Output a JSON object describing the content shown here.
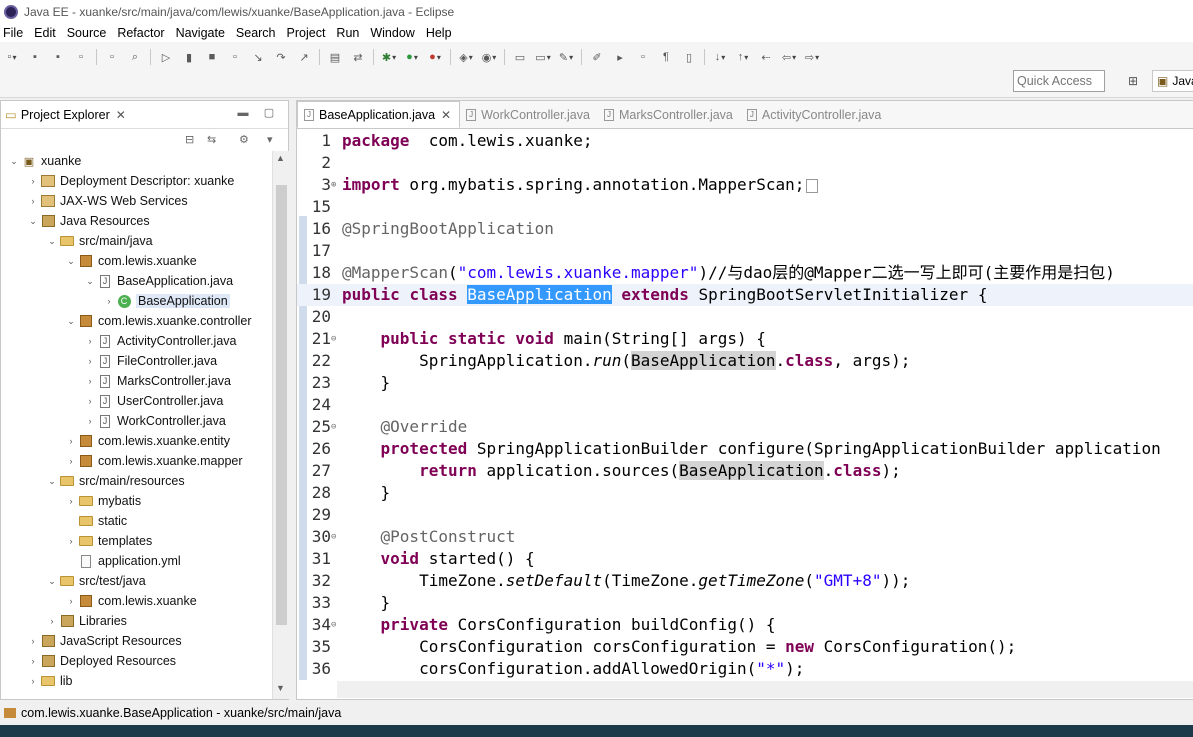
{
  "window": {
    "title": "Java EE - xuanke/src/main/java/com/lewis/xuanke/BaseApplication.java - Eclipse"
  },
  "menu": [
    "File",
    "Edit",
    "Source",
    "Refactor",
    "Navigate",
    "Search",
    "Project",
    "Run",
    "Window",
    "Help"
  ],
  "toolbar": {
    "quick_access": "Quick Access",
    "perspective": "Java"
  },
  "explorer": {
    "title": "Project Explorer",
    "tree": [
      {
        "depth": 0,
        "twisty": "open",
        "icon": "project",
        "label": "xuanke"
      },
      {
        "depth": 1,
        "twisty": "closed",
        "icon": "dd",
        "label": "Deployment Descriptor: xuanke"
      },
      {
        "depth": 1,
        "twisty": "closed",
        "icon": "dd",
        "label": "JAX-WS Web Services"
      },
      {
        "depth": 1,
        "twisty": "open",
        "icon": "lib",
        "label": "Java Resources"
      },
      {
        "depth": 2,
        "twisty": "open",
        "icon": "pkgfolder",
        "label": "src/main/java"
      },
      {
        "depth": 3,
        "twisty": "open",
        "icon": "pkg",
        "label": "com.lewis.xuanke"
      },
      {
        "depth": 4,
        "twisty": "open",
        "icon": "java",
        "label": "BaseApplication.java"
      },
      {
        "depth": 5,
        "twisty": "closed",
        "icon": "class",
        "label": "BaseApplication",
        "selected": true
      },
      {
        "depth": 3,
        "twisty": "open",
        "icon": "pkg",
        "label": "com.lewis.xuanke.controller"
      },
      {
        "depth": 4,
        "twisty": "closed",
        "icon": "java",
        "label": "ActivityController.java"
      },
      {
        "depth": 4,
        "twisty": "closed",
        "icon": "java",
        "label": "FileController.java"
      },
      {
        "depth": 4,
        "twisty": "closed",
        "icon": "java",
        "label": "MarksController.java"
      },
      {
        "depth": 4,
        "twisty": "closed",
        "icon": "java",
        "label": "UserController.java"
      },
      {
        "depth": 4,
        "twisty": "closed",
        "icon": "java",
        "label": "WorkController.java"
      },
      {
        "depth": 3,
        "twisty": "closed",
        "icon": "pkg",
        "label": "com.lewis.xuanke.entity"
      },
      {
        "depth": 3,
        "twisty": "closed",
        "icon": "pkg",
        "label": "com.lewis.xuanke.mapper"
      },
      {
        "depth": 2,
        "twisty": "open",
        "icon": "pkgfolder",
        "label": "src/main/resources"
      },
      {
        "depth": 3,
        "twisty": "closed",
        "icon": "folder",
        "label": "mybatis"
      },
      {
        "depth": 3,
        "twisty": "none",
        "icon": "folder",
        "label": "static"
      },
      {
        "depth": 3,
        "twisty": "closed",
        "icon": "folder",
        "label": "templates"
      },
      {
        "depth": 3,
        "twisty": "none",
        "icon": "file",
        "label": "application.yml"
      },
      {
        "depth": 2,
        "twisty": "open",
        "icon": "pkgfolder",
        "label": "src/test/java"
      },
      {
        "depth": 3,
        "twisty": "closed",
        "icon": "pkg",
        "label": "com.lewis.xuanke"
      },
      {
        "depth": 2,
        "twisty": "closed",
        "icon": "lib",
        "label": "Libraries"
      },
      {
        "depth": 1,
        "twisty": "closed",
        "icon": "lib",
        "label": "JavaScript Resources"
      },
      {
        "depth": 1,
        "twisty": "closed",
        "icon": "lib",
        "label": "Deployed Resources"
      },
      {
        "depth": 1,
        "twisty": "closed",
        "icon": "folder",
        "label": "lib"
      }
    ]
  },
  "editor": {
    "tabs": [
      {
        "label": "BaseApplication.java",
        "active": true
      },
      {
        "label": "WorkController.java",
        "active": false
      },
      {
        "label": "MarksController.java",
        "active": false
      },
      {
        "label": "ActivityController.java",
        "active": false
      }
    ],
    "lines": [
      {
        "n": "1",
        "fold": "",
        "segs": [
          [
            "kw",
            "package"
          ],
          [
            "",
            "  com.lewis.xuanke;"
          ]
        ]
      },
      {
        "n": "2",
        "fold": "",
        "segs": []
      },
      {
        "n": "3",
        "fold": "⊕",
        "segs": [
          [
            "kw",
            "import"
          ],
          [
            "",
            " org.mybatis.spring.annotation.MapperScan;"
          ],
          [
            "box",
            ""
          ]
        ]
      },
      {
        "n": "15",
        "fold": "",
        "segs": []
      },
      {
        "n": "16",
        "fold": "",
        "segs": [
          [
            "ann",
            "@SpringBootApplication"
          ]
        ]
      },
      {
        "n": "17",
        "fold": "",
        "segs": []
      },
      {
        "n": "18",
        "fold": "",
        "segs": [
          [
            "ann",
            "@MapperScan"
          ],
          [
            "",
            "("
          ],
          [
            "str",
            "\"com.lewis.xuanke.mapper\""
          ],
          [
            "",
            ")//与dao层的@Mapper二选一写上即可(主要作用是扫包)"
          ]
        ]
      },
      {
        "n": "19",
        "fold": "",
        "cur": true,
        "segs": [
          [
            "kw",
            "public"
          ],
          [
            "",
            " "
          ],
          [
            "kw",
            "class"
          ],
          [
            "",
            " "
          ],
          [
            "sel",
            "BaseApplication"
          ],
          [
            "",
            " "
          ],
          [
            "kw",
            "extends"
          ],
          [
            "",
            " SpringBootServletInitializer {"
          ]
        ]
      },
      {
        "n": "20",
        "fold": "",
        "segs": []
      },
      {
        "n": "21",
        "fold": "⊖",
        "segs": [
          [
            "",
            "    "
          ],
          [
            "kw",
            "public"
          ],
          [
            "",
            " "
          ],
          [
            "kw",
            "static"
          ],
          [
            "",
            " "
          ],
          [
            "kw",
            "void"
          ],
          [
            "",
            " main(String[] args) {"
          ]
        ]
      },
      {
        "n": "22",
        "fold": "",
        "segs": [
          [
            "",
            "        SpringApplication."
          ],
          [
            "it",
            "run"
          ],
          [
            "",
            "("
          ],
          [
            "hl",
            "BaseApplication"
          ],
          [
            "",
            "."
          ],
          [
            "kw",
            "class"
          ],
          [
            "",
            ", args);"
          ]
        ]
      },
      {
        "n": "23",
        "fold": "",
        "segs": [
          [
            "",
            "    }"
          ]
        ]
      },
      {
        "n": "24",
        "fold": "",
        "segs": []
      },
      {
        "n": "25",
        "fold": "⊖",
        "segs": [
          [
            "",
            "    "
          ],
          [
            "ann",
            "@Override"
          ]
        ]
      },
      {
        "n": "26",
        "fold": "",
        "segs": [
          [
            "",
            "    "
          ],
          [
            "kw",
            "protected"
          ],
          [
            "",
            " SpringApplicationBuilder configure(SpringApplicationBuilder application"
          ]
        ]
      },
      {
        "n": "27",
        "fold": "",
        "segs": [
          [
            "",
            "        "
          ],
          [
            "kw",
            "return"
          ],
          [
            "",
            " application.sources("
          ],
          [
            "hl",
            "BaseApplication"
          ],
          [
            "",
            "."
          ],
          [
            "kw",
            "class"
          ],
          [
            "",
            ");"
          ]
        ]
      },
      {
        "n": "28",
        "fold": "",
        "segs": [
          [
            "",
            "    }"
          ]
        ]
      },
      {
        "n": "29",
        "fold": "",
        "segs": []
      },
      {
        "n": "30",
        "fold": "⊖",
        "segs": [
          [
            "",
            "    "
          ],
          [
            "ann",
            "@PostConstruct"
          ]
        ]
      },
      {
        "n": "31",
        "fold": "",
        "segs": [
          [
            "",
            "    "
          ],
          [
            "kw",
            "void"
          ],
          [
            "",
            " started() {"
          ]
        ]
      },
      {
        "n": "32",
        "fold": "",
        "segs": [
          [
            "",
            "        TimeZone."
          ],
          [
            "it",
            "setDefault"
          ],
          [
            "",
            "(TimeZone."
          ],
          [
            "it",
            "getTimeZone"
          ],
          [
            "",
            "("
          ],
          [
            "str",
            "\"GMT+8\""
          ],
          [
            "",
            "));"
          ]
        ]
      },
      {
        "n": "33",
        "fold": "",
        "segs": [
          [
            "",
            "    }"
          ]
        ]
      },
      {
        "n": "34",
        "fold": "⊖",
        "segs": [
          [
            "",
            "    "
          ],
          [
            "kw",
            "private"
          ],
          [
            "",
            " CorsConfiguration buildConfig() {"
          ]
        ]
      },
      {
        "n": "35",
        "fold": "",
        "segs": [
          [
            "",
            "        CorsConfiguration corsConfiguration = "
          ],
          [
            "kw",
            "new"
          ],
          [
            "",
            " CorsConfiguration();"
          ]
        ]
      },
      {
        "n": "36",
        "fold": "",
        "segs": [
          [
            "",
            "        corsConfiguration.addAllowedOrigin("
          ],
          [
            "str",
            "\"*\""
          ],
          [
            "",
            ");"
          ]
        ]
      }
    ]
  },
  "status": {
    "text": "com.lewis.xuanke.BaseApplication - xuanke/src/main/java"
  }
}
